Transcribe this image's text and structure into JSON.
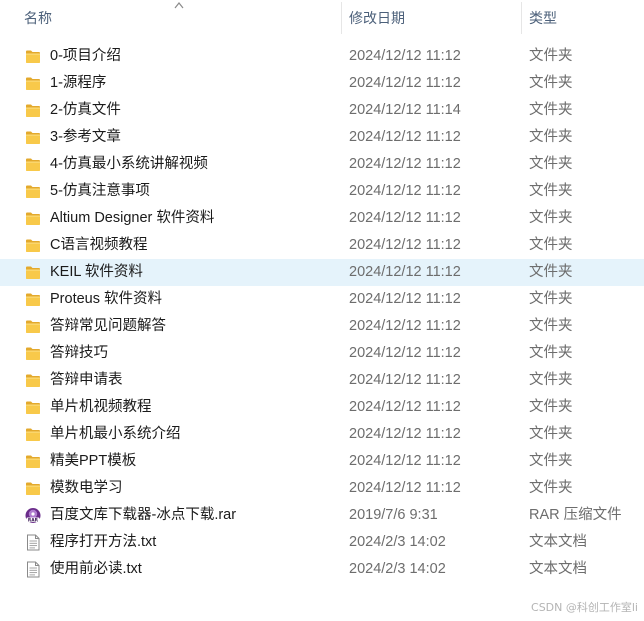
{
  "columns": {
    "name": "名称",
    "date": "修改日期",
    "type": "类型"
  },
  "files": [
    {
      "name": "0-项目介绍",
      "date": "2024/12/12 11:12",
      "type": "文件夹",
      "icon": "folder-icon"
    },
    {
      "name": "1-源程序",
      "date": "2024/12/12 11:12",
      "type": "文件夹",
      "icon": "folder-icon"
    },
    {
      "name": "2-仿真文件",
      "date": "2024/12/12 11:14",
      "type": "文件夹",
      "icon": "folder-icon"
    },
    {
      "name": "3-参考文章",
      "date": "2024/12/12 11:12",
      "type": "文件夹",
      "icon": "folder-icon"
    },
    {
      "name": "4-仿真最小系统讲解视频",
      "date": "2024/12/12 11:12",
      "type": "文件夹",
      "icon": "folder-icon"
    },
    {
      "name": "5-仿真注意事项",
      "date": "2024/12/12 11:12",
      "type": "文件夹",
      "icon": "folder-icon"
    },
    {
      "name": "Altium Designer 软件资料",
      "date": "2024/12/12 11:12",
      "type": "文件夹",
      "icon": "folder-icon"
    },
    {
      "name": "C语言视频教程",
      "date": "2024/12/12 11:12",
      "type": "文件夹",
      "icon": "folder-icon"
    },
    {
      "name": "KEIL 软件资料",
      "date": "2024/12/12 11:12",
      "type": "文件夹",
      "icon": "folder-icon",
      "hover": true
    },
    {
      "name": "Proteus 软件资料",
      "date": "2024/12/12 11:12",
      "type": "文件夹",
      "icon": "folder-icon"
    },
    {
      "name": "答辩常见问题解答",
      "date": "2024/12/12 11:12",
      "type": "文件夹",
      "icon": "folder-icon"
    },
    {
      "name": "答辩技巧",
      "date": "2024/12/12 11:12",
      "type": "文件夹",
      "icon": "folder-icon"
    },
    {
      "name": "答辩申请表",
      "date": "2024/12/12 11:12",
      "type": "文件夹",
      "icon": "folder-icon"
    },
    {
      "name": "单片机视频教程",
      "date": "2024/12/12 11:12",
      "type": "文件夹",
      "icon": "folder-icon"
    },
    {
      "name": "单片机最小系统介绍",
      "date": "2024/12/12 11:12",
      "type": "文件夹",
      "icon": "folder-icon"
    },
    {
      "name": "精美PPT模板",
      "date": "2024/12/12 11:12",
      "type": "文件夹",
      "icon": "folder-icon"
    },
    {
      "name": "模数电学习",
      "date": "2024/12/12 11:12",
      "type": "文件夹",
      "icon": "folder-icon"
    },
    {
      "name": "百度文库下载器-冰点下载.rar",
      "date": "2019/7/6 9:31",
      "type": "RAR 压缩文件",
      "icon": "rar-archive-icon"
    },
    {
      "name": "程序打开方法.txt",
      "date": "2024/2/3 14:02",
      "type": "文本文档",
      "icon": "text-file-icon"
    },
    {
      "name": "使用前必读.txt",
      "date": "2024/2/3 14:02",
      "type": "文本文档",
      "icon": "text-file-icon"
    }
  ],
  "watermark": "CSDN @科创工作室li",
  "colors": {
    "header_text": "#4c607a",
    "hover_row": "#e5f3fb",
    "folder_yellow": "#f8c94a",
    "folder_dark": "#e3a92c",
    "rar_purple": "#6a2c8a"
  }
}
